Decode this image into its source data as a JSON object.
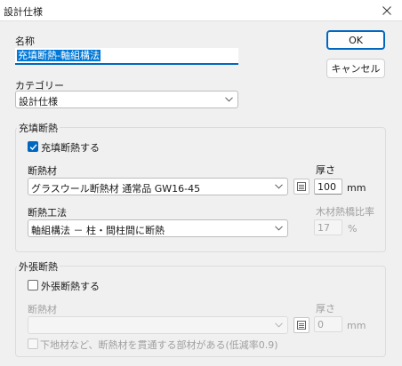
{
  "window": {
    "title": "設計仕様"
  },
  "name_label": "名称",
  "name_value": "充填断熱-軸組構法",
  "buttons": {
    "ok": "OK",
    "cancel": "キャンセル"
  },
  "category": {
    "label": "カテゴリー",
    "value": "設計仕様"
  },
  "infill": {
    "group_title": "充填断熱",
    "enable_label": "充填断熱する",
    "enabled": true,
    "material_label": "断熱材",
    "material_value": "グラスウール断熱材 通常品 GW16-45",
    "thickness_label": "厚さ",
    "thickness_value": "100",
    "thickness_unit": "mm",
    "method_label": "断熱工法",
    "method_value": "軸組構法 － 柱・間柱間に断熱",
    "ratio_label": "木材熱橋比率",
    "ratio_value": "17",
    "ratio_unit": "%"
  },
  "exterior": {
    "group_title": "外張断熱",
    "enable_label": "外張断熱する",
    "enabled": false,
    "material_label": "断熱材",
    "material_value": "",
    "thickness_label": "厚さ",
    "thickness_value": "0",
    "thickness_unit": "mm",
    "penetration_label": "下地材など、断熱材を貫通する部材がある(低減率0.9)",
    "penetration_checked": false
  },
  "colors": {
    "accent": "#0067c0",
    "selection": "#0078d7"
  }
}
